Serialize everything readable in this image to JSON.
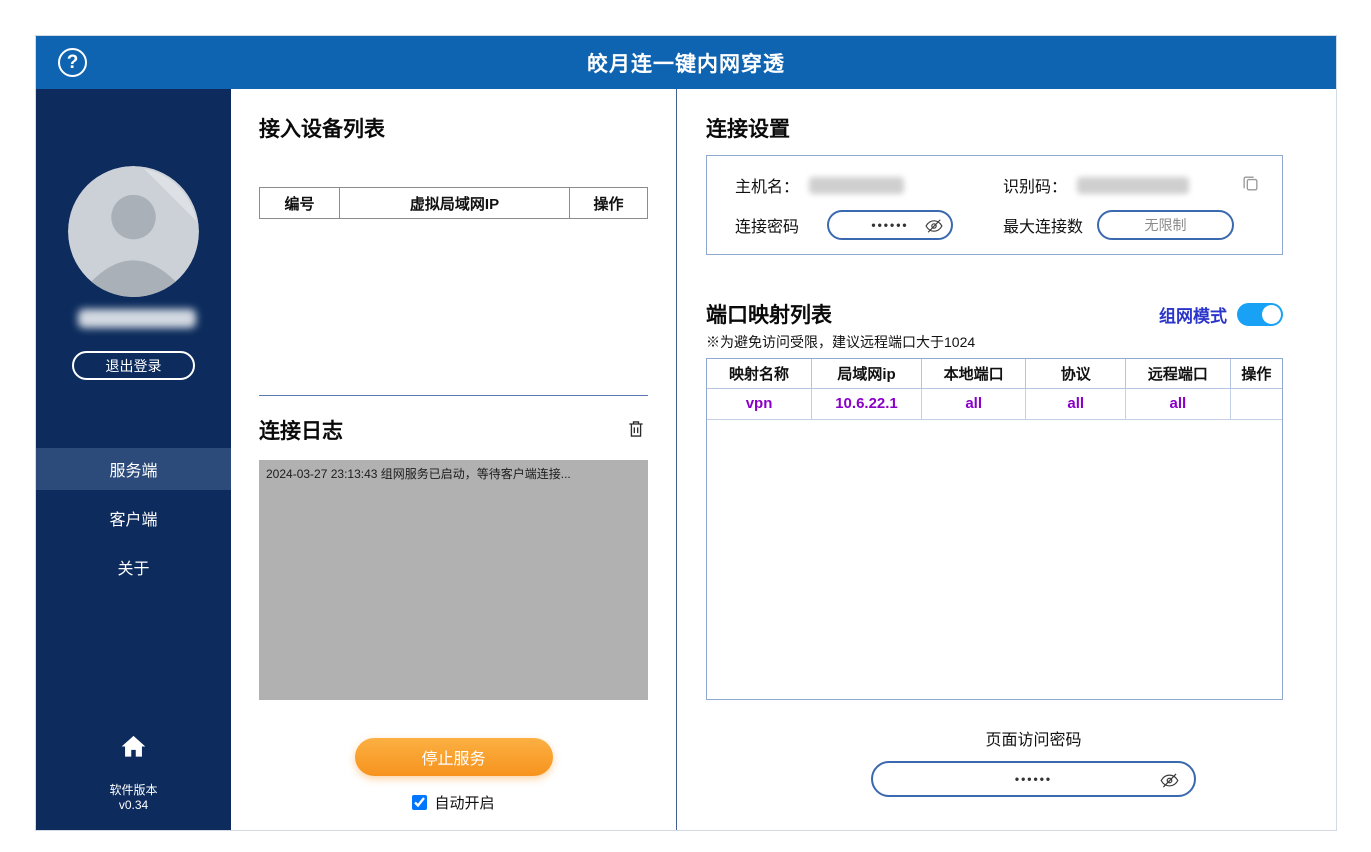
{
  "window": {
    "title": "皎月连一键内网穿透"
  },
  "sidebar": {
    "logout_button": "退出登录",
    "menu": [
      {
        "label": "服务端",
        "active": true
      },
      {
        "label": "客户端",
        "active": false
      },
      {
        "label": "关于",
        "active": false
      }
    ],
    "version_label": "软件版本",
    "version_number": "v0.34"
  },
  "device_list": {
    "title": "接入设备列表",
    "columns": [
      "编号",
      "虚拟局域网IP",
      "操作"
    ],
    "rows": []
  },
  "log": {
    "title": "连接日志",
    "entries": [
      "2024-03-27 23:13:43 组网服务已启动，等待客户端连接..."
    ]
  },
  "service_controls": {
    "stop_button": "停止服务",
    "autostart_label": "自动开启",
    "autostart_checked": "checked"
  },
  "connection_settings": {
    "title": "连接设置",
    "hostname_label": "主机名：",
    "id_code_label": "识别码：",
    "password_label": "连接密码",
    "password_masked": "••••••",
    "max_connections_label": "最大连接数",
    "max_connections_value": "无限制"
  },
  "port_mapping": {
    "title": "端口映射列表",
    "network_mode_label": "组网模式",
    "network_mode_on": true,
    "note": "※为避免访问受限，建议远程端口大于1024",
    "columns": [
      "映射名称",
      "局域网ip",
      "本地端口",
      "协议",
      "远程端口",
      "操作"
    ],
    "rows": [
      {
        "name": "vpn",
        "lan_ip": "10.6.22.1",
        "local_port": "all",
        "protocol": "all",
        "remote_port": "all",
        "action": ""
      }
    ]
  },
  "page_access": {
    "label": "页面访问密码",
    "password_masked": "••••••"
  },
  "colors": {
    "header_blue": "#0e64b1",
    "sidebar_navy": "#0d2c5d",
    "sidebar_active": "#2c4b7a",
    "button_orange": "#f7931e",
    "mapping_row_purple": "#8b00c8",
    "network_mode_blue": "#2b36c9",
    "toggle_blue": "#19a2f5"
  }
}
